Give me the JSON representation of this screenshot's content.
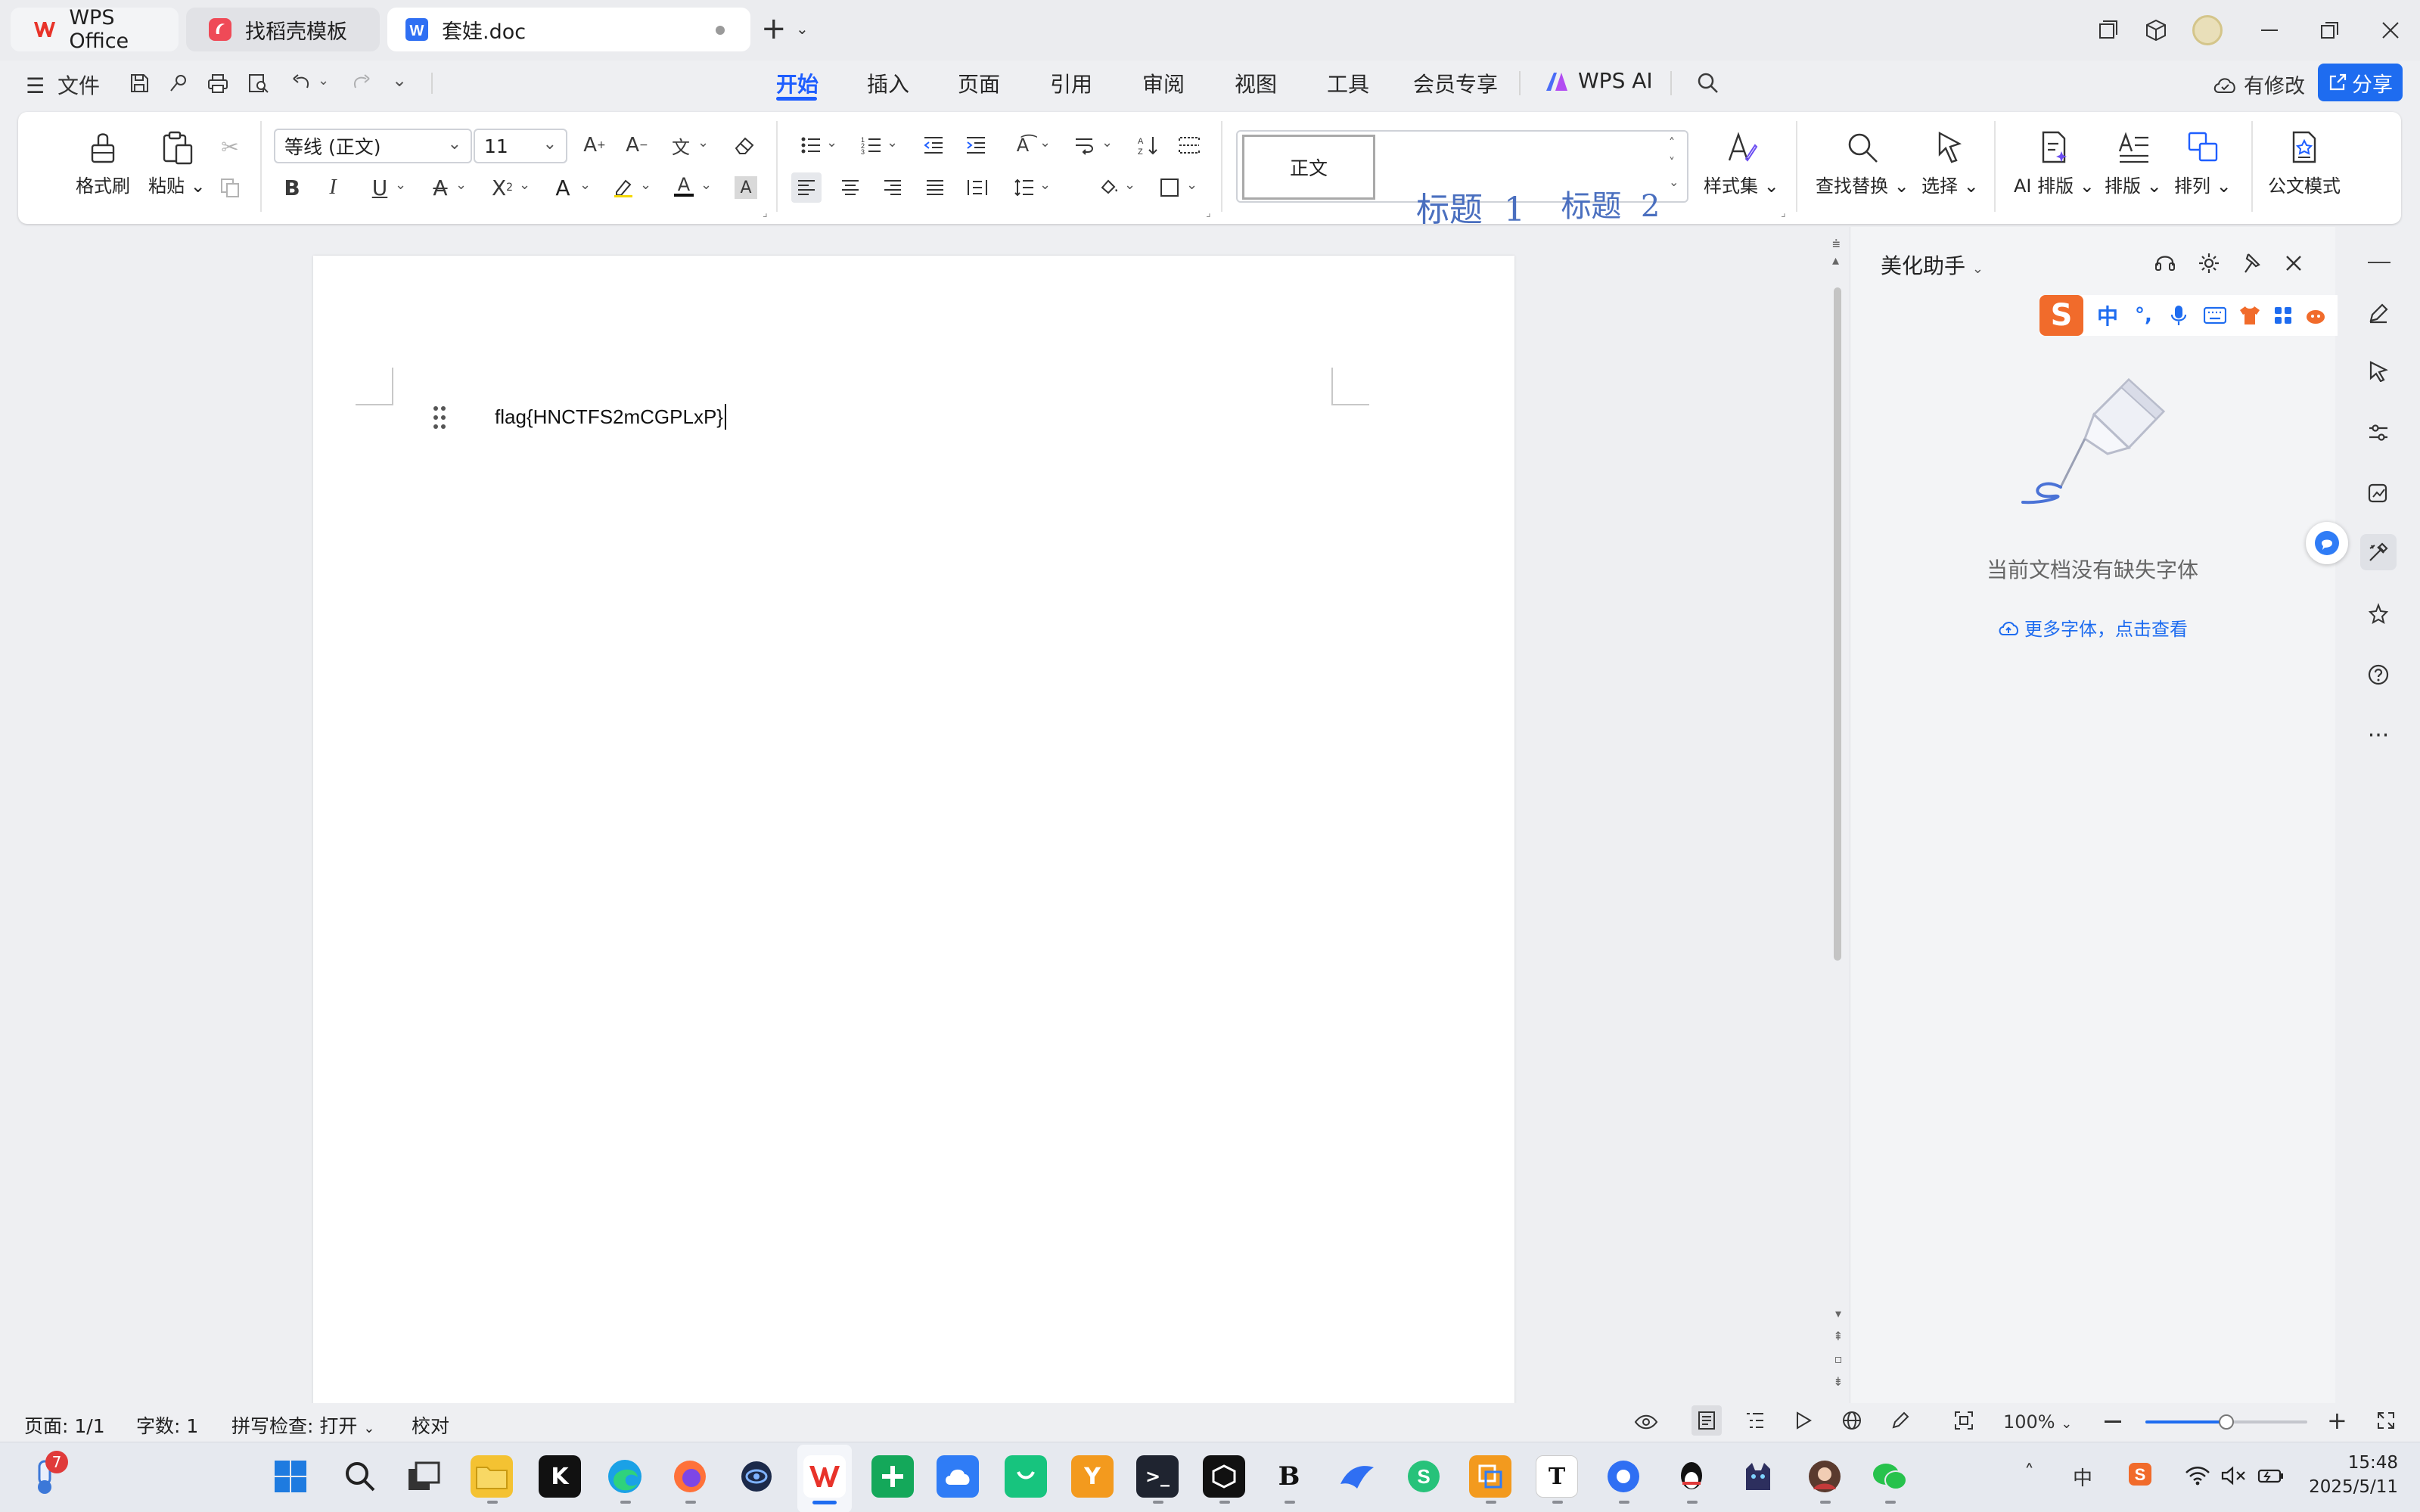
{
  "tabs": [
    {
      "label": "WPS Office"
    },
    {
      "label": "找稻壳模板"
    },
    {
      "label": "套娃.doc"
    }
  ],
  "menubar": {
    "file_label": "文件",
    "tabs": [
      "开始",
      "插入",
      "页面",
      "引用",
      "审阅",
      "视图",
      "工具",
      "会员专享",
      "WPS AI"
    ],
    "active_tab": "开始",
    "modify_label": "有修改",
    "share_label": "分享"
  },
  "ribbon": {
    "format_painter": "格式刷",
    "paste": "粘贴",
    "font_name": "等线 (正文)",
    "font_size": "11",
    "styles": [
      "正文",
      "标题  1",
      "标题  2"
    ],
    "style_set": "样式集",
    "find_replace": "查找替换",
    "select": "选择",
    "ai_layout": "AI 排版",
    "layout": "排版",
    "arrange": "排列",
    "official_mode": "公文模式"
  },
  "document": {
    "text": "flag{HNCTFS2mCGPLxP}"
  },
  "side_panel": {
    "title": "美化助手",
    "message": "当前文档没有缺失字体",
    "link": "更多字体，点击查看",
    "ime": [
      "中",
      "°,"
    ]
  },
  "statusbar": {
    "page": "页面: 1/1",
    "word_count": "字数: 1",
    "spellcheck": "拼写检查: 打开",
    "proofread": "校对",
    "zoom": "100%",
    "zoom_level": 0.5
  },
  "taskbar": {
    "badge": "7",
    "time": "15:48",
    "date": "2025/5/11",
    "ime_indicator": "中"
  },
  "colors": {
    "accent": "#1e5eff",
    "wps_red": "#e8332a",
    "share_bg": "#1e6cf0"
  }
}
